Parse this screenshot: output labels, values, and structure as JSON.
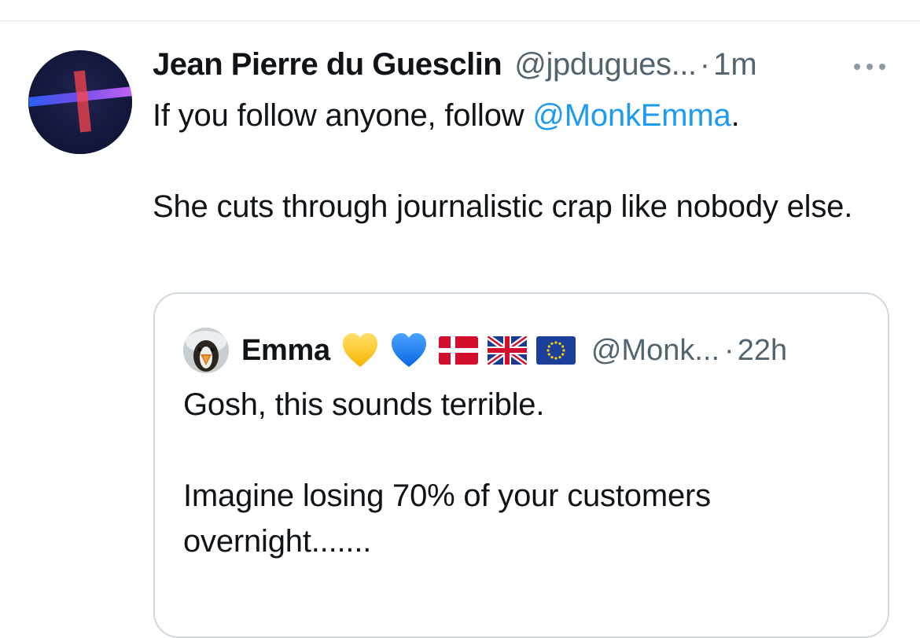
{
  "tweet": {
    "author_name": "Jean Pierre du Guesclin",
    "author_handle": "@jpdugues...",
    "separator": "·",
    "time": "1m",
    "text_before_mention": "If you follow anyone, follow ",
    "mention": "@MonkEmma",
    "text_after_mention": ".",
    "paragraph2": "She cuts through journalistic crap like nobody else."
  },
  "quote": {
    "author_name": "Emma",
    "emojis": [
      "yellow-heart",
      "blue-heart",
      "denmark-flag",
      "uk-flag",
      "eu-flag"
    ],
    "author_handle": "@Monk...",
    "separator": "·",
    "time": "22h",
    "paragraph1": "Gosh, this sounds terrible.",
    "paragraph2": "Imagine losing 70% of your customers overnight......."
  },
  "icons": {
    "more": "more-horizontal-icon"
  },
  "colors": {
    "text_primary": "#0f1419",
    "text_secondary": "#536471",
    "link": "#1d9bf0",
    "border": "#cfd9de"
  }
}
